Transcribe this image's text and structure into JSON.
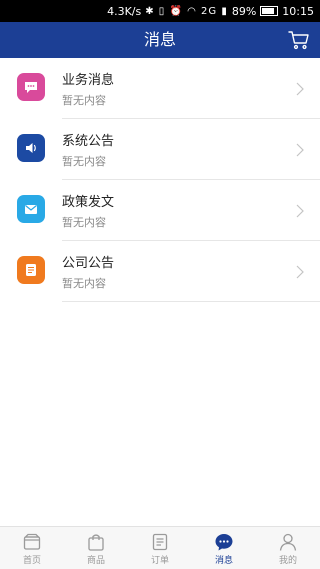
{
  "status_bar": {
    "network_speed": "4.3K/s",
    "battery": "89%",
    "time": "10:15",
    "signal_label": "2G"
  },
  "header": {
    "title": "消息"
  },
  "messages": [
    {
      "title": "业务消息",
      "subtitle": "暂无内容",
      "color": "#d94a9b",
      "icon": "chat-bubble-icon"
    },
    {
      "title": "系统公告",
      "subtitle": "暂无内容",
      "color": "#1c4aa3",
      "icon": "speaker-icon"
    },
    {
      "title": "政策发文",
      "subtitle": "暂无内容",
      "color": "#29a9e6",
      "icon": "envelope-icon"
    },
    {
      "title": "公司公告",
      "subtitle": "暂无内容",
      "color": "#f07a1e",
      "icon": "document-icon"
    }
  ],
  "tabs": [
    {
      "label": "首页",
      "icon": "home-icon",
      "active": false
    },
    {
      "label": "商品",
      "icon": "bag-icon",
      "active": false
    },
    {
      "label": "订单",
      "icon": "order-icon",
      "active": false
    },
    {
      "label": "消息",
      "icon": "message-icon",
      "active": true
    },
    {
      "label": "我的",
      "icon": "person-icon",
      "active": false
    }
  ],
  "colors": {
    "header_bg": "#1c3f95",
    "accent": "#1c3f95",
    "inactive": "#9a9a9a"
  }
}
